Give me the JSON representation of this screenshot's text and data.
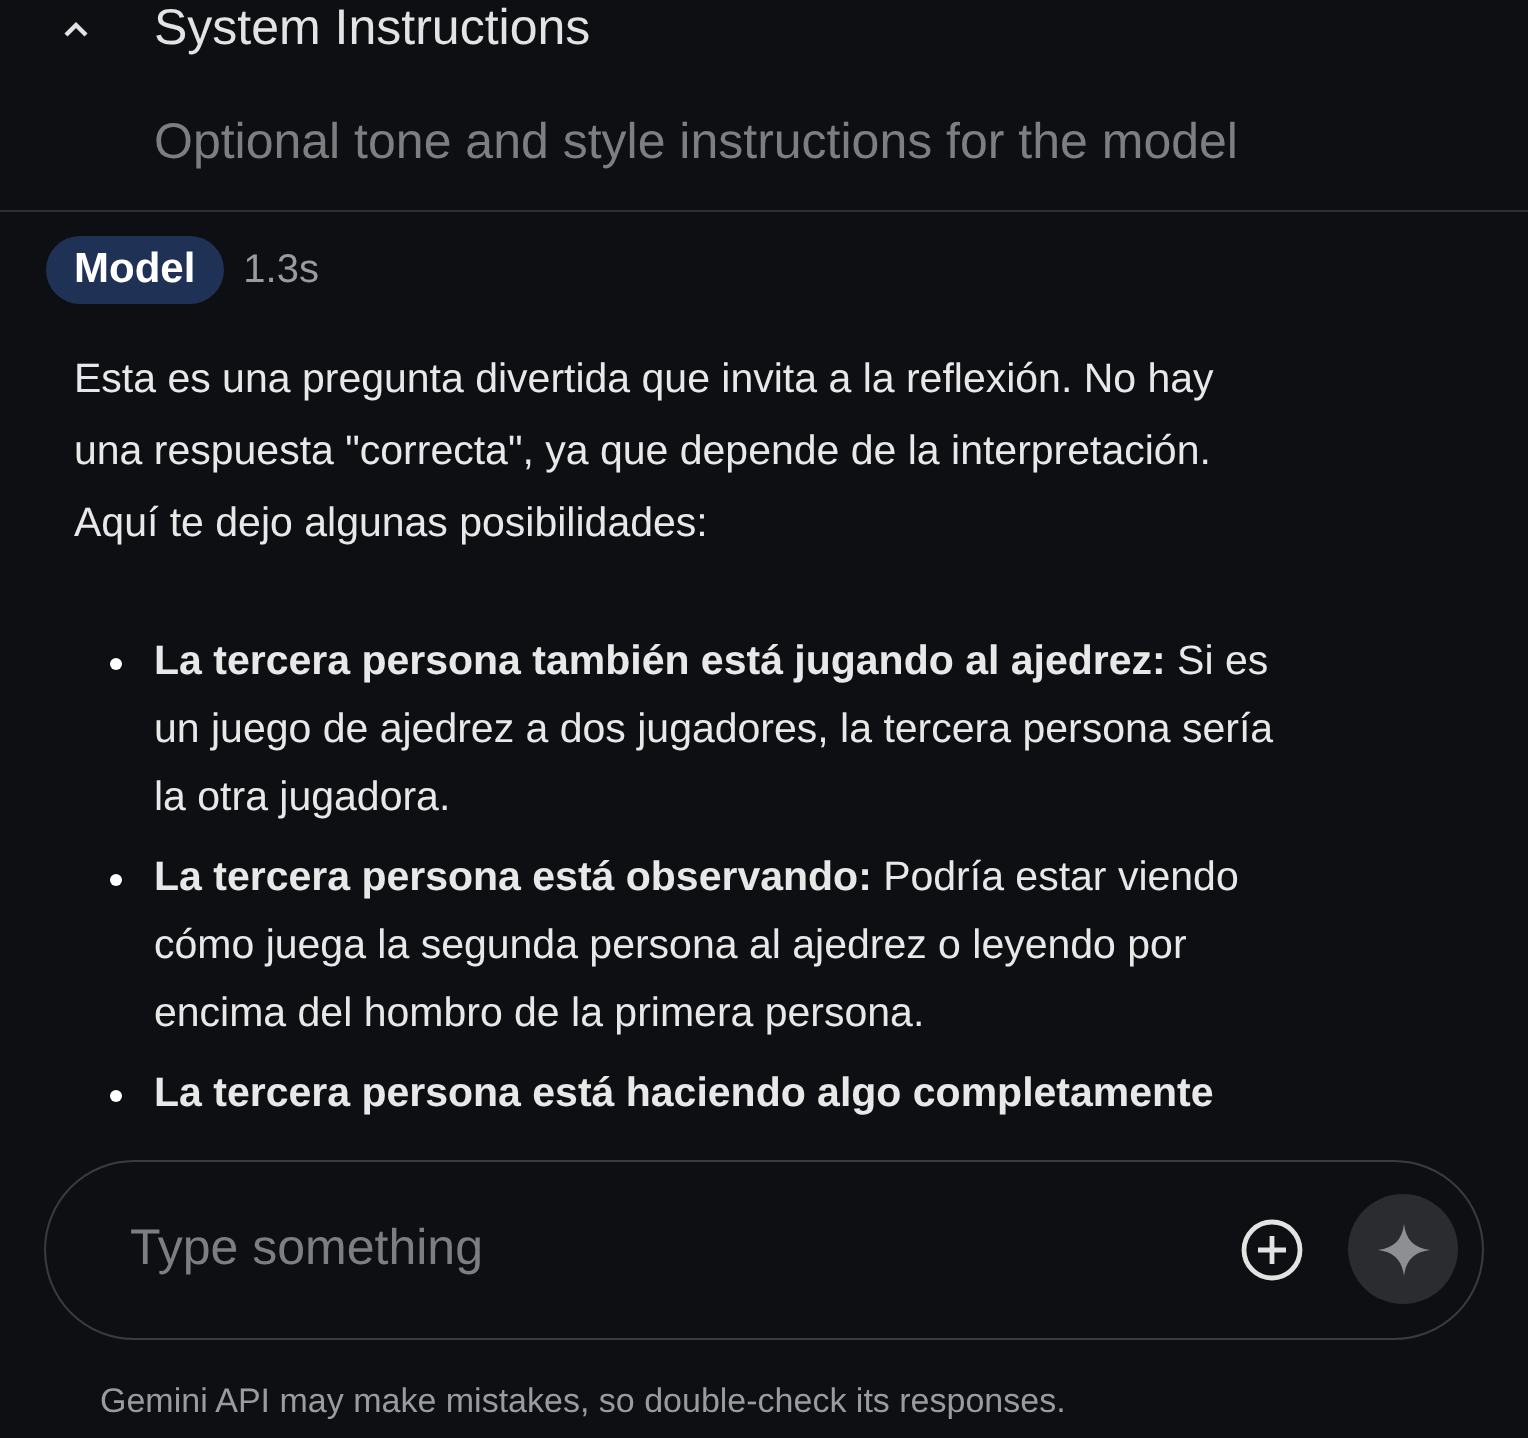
{
  "section": {
    "title": "System Instructions",
    "expanded": true,
    "placeholder": "Optional tone and style instructions for the model"
  },
  "message": {
    "role": "Model",
    "time": "1.3s",
    "intro": "Esta es una pregunta divertida que invita a la reflexión. No hay una respuesta \"correcta\", ya que depende de la interpretación. Aquí te dejo algunas posibilidades:",
    "bullets": [
      {
        "text": "**La tercera persona también está jugando al ajedrez:** Si es un juego de ajedrez a dos jugadores, la tercera persona sería la otra jugadora."
      },
      {
        "text": "**La tercera persona está observando:** Podría estar viendo cómo juega la segunda persona al ajedrez o leyendo por encima del hombro de la primera persona."
      },
      {
        "text": "**La tercera persona está haciendo algo completamente**"
      }
    ]
  },
  "composer": {
    "placeholder": "Type something"
  },
  "footer": "Gemini API may make mistakes, so double-check its responses."
}
